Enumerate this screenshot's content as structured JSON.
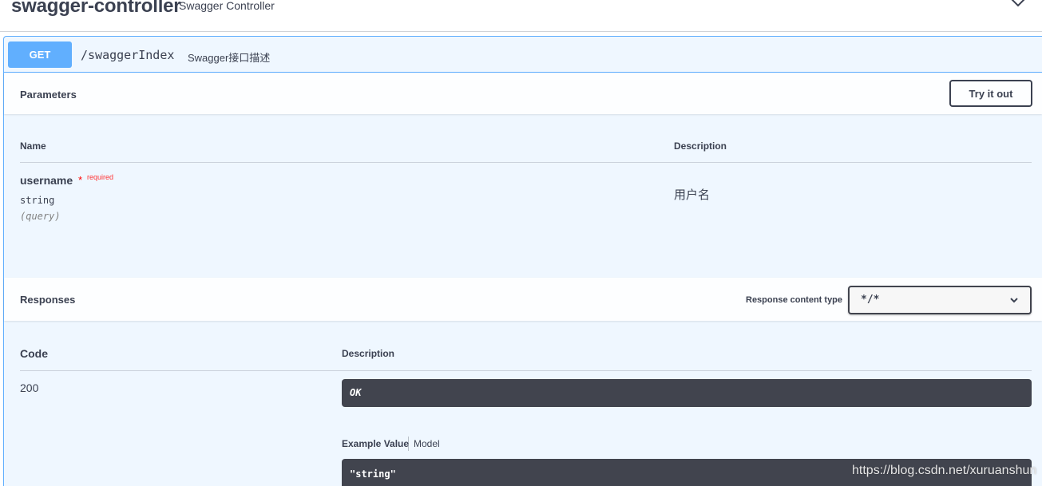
{
  "tag": {
    "name": "swagger-controller",
    "description": "Swagger Controller"
  },
  "operation": {
    "method": "GET",
    "path": "/swaggerIndex",
    "summary": "Swagger接口描述"
  },
  "parameters": {
    "title": "Parameters",
    "try_button": "Try it out",
    "col_name": "Name",
    "col_description": "Description",
    "items": [
      {
        "name": "username",
        "required_star": "*",
        "required_label": "required",
        "type": "string",
        "in": "(query)",
        "description": "用户名"
      }
    ]
  },
  "responses": {
    "title": "Responses",
    "content_type_label": "Response content type",
    "content_type_value": "*/*",
    "col_code": "Code",
    "col_description": "Description",
    "items": [
      {
        "code": "200",
        "description": "OK",
        "tab_example": "Example Value",
        "tab_model": "Model",
        "example": "\"string\""
      }
    ]
  },
  "watermark": "https://blog.csdn.net/xuruanshun",
  "colors": {
    "get_accent": "#61affe",
    "code_bg": "#41444e",
    "text": "#3b4151",
    "required": "#ff0000"
  }
}
